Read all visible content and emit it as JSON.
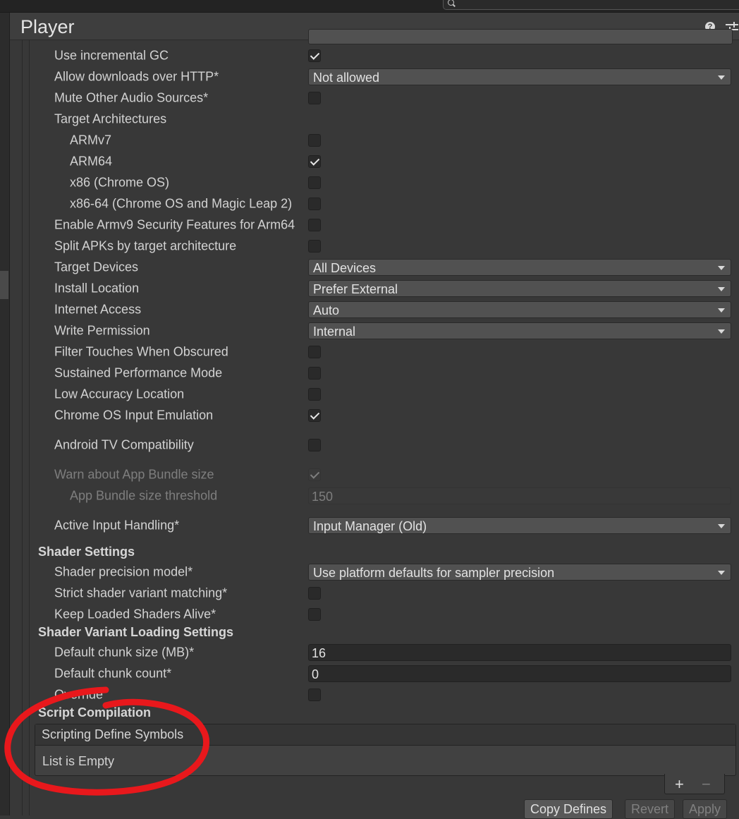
{
  "window": {
    "title": "Player"
  },
  "partial_top_row": {},
  "rows": [
    {
      "kind": "checkbox",
      "label": "Use incremental GC",
      "checked": true,
      "indent": false
    },
    {
      "kind": "dropdown",
      "label": "Allow downloads over HTTP*",
      "value": "Not allowed"
    },
    {
      "kind": "checkbox",
      "label": "Mute Other Audio Sources*",
      "checked": false
    },
    {
      "kind": "header-label",
      "label": "Target Architectures"
    },
    {
      "kind": "checkbox",
      "label": "ARMv7",
      "checked": false,
      "indent": true
    },
    {
      "kind": "checkbox",
      "label": "ARM64",
      "checked": true,
      "indent": true
    },
    {
      "kind": "checkbox",
      "label": "x86 (Chrome OS)",
      "checked": false,
      "indent": true
    },
    {
      "kind": "checkbox",
      "label": "x86-64 (Chrome OS and Magic Leap 2)",
      "checked": false,
      "indent": true
    },
    {
      "kind": "checkbox",
      "label": "Enable Armv9 Security Features for Arm64",
      "checked": false
    },
    {
      "kind": "checkbox",
      "label": "Split APKs by target architecture",
      "checked": false
    },
    {
      "kind": "dropdown",
      "label": "Target Devices",
      "value": "All Devices"
    },
    {
      "kind": "dropdown",
      "label": "Install Location",
      "value": "Prefer External"
    },
    {
      "kind": "dropdown",
      "label": "Internet Access",
      "value": "Auto"
    },
    {
      "kind": "dropdown",
      "label": "Write Permission",
      "value": "Internal"
    },
    {
      "kind": "checkbox",
      "label": "Filter Touches When Obscured",
      "checked": false
    },
    {
      "kind": "checkbox",
      "label": "Sustained Performance Mode",
      "checked": false
    },
    {
      "kind": "checkbox",
      "label": "Low Accuracy Location",
      "checked": false
    },
    {
      "kind": "checkbox",
      "label": "Chrome OS Input Emulation",
      "checked": true
    },
    {
      "kind": "checkbox",
      "label": "Android TV Compatibility",
      "checked": false
    },
    {
      "kind": "checkbox",
      "label": "Warn about App Bundle size",
      "checked": true,
      "disabled": true
    },
    {
      "kind": "textfield",
      "label": "App Bundle size threshold",
      "value": "150",
      "indent": true,
      "disabled": true
    },
    {
      "kind": "dropdown",
      "label": "Active Input Handling*",
      "value": "Input Manager (Old)"
    }
  ],
  "shader_settings": {
    "title": "Shader Settings",
    "rows": [
      {
        "kind": "dropdown",
        "label": "Shader precision model*",
        "value": "Use platform defaults for sampler precision"
      },
      {
        "kind": "checkbox",
        "label": "Strict shader variant matching*",
        "checked": false
      },
      {
        "kind": "checkbox",
        "label": "Keep Loaded Shaders Alive*",
        "checked": false
      }
    ]
  },
  "shader_variant_loading": {
    "title": "Shader Variant Loading Settings",
    "rows": [
      {
        "kind": "textfield",
        "label": "Default chunk size (MB)*",
        "value": "16"
      },
      {
        "kind": "textfield",
        "label": "Default chunk count*",
        "value": "0"
      },
      {
        "kind": "checkbox",
        "label": "Override",
        "checked": false
      }
    ]
  },
  "script_compilation": {
    "title": "Script Compilation",
    "list_header": "Scripting Define Symbols",
    "empty_text": "List is Empty",
    "add_symbol": "+",
    "remove_symbol": "−"
  },
  "buttons": {
    "copy_defines": "Copy Defines",
    "revert": "Revert",
    "apply": "Apply"
  },
  "colors": {
    "background": "#383838",
    "annotation": "#e8181c"
  },
  "icons": [
    "search-icon",
    "help-icon",
    "presets-icon",
    "checkmark-icon",
    "dropdown-caret-icon",
    "plus-icon",
    "minus-icon"
  ]
}
